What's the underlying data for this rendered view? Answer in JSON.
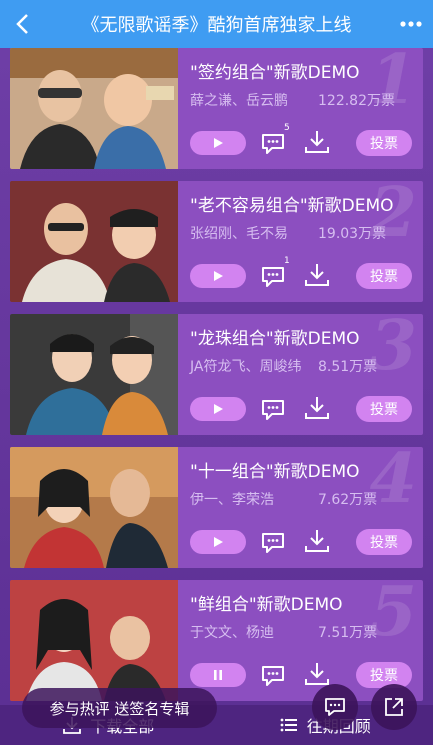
{
  "header": {
    "back_icon": "chevron-left-icon",
    "title": "《无限歌谣季》酷狗首席独家上线",
    "more_icon": "more-dots-icon"
  },
  "songs": [
    {
      "rank": "1",
      "title": "\"签约组合\"新歌DEMO",
      "artists": "薛之谦、岳云鹏",
      "votes": "122.82万票",
      "comments": "5",
      "play_state": "play",
      "vote_label": "投票"
    },
    {
      "rank": "2",
      "title": "\"老不容易组合\"新歌DEMO",
      "artists": "张绍刚、毛不易",
      "votes": "19.03万票",
      "comments": "1",
      "play_state": "play",
      "vote_label": "投票"
    },
    {
      "rank": "3",
      "title": "\"龙珠组合\"新歌DEMO",
      "artists": "JA符龙飞、周峻纬",
      "votes": "8.51万票",
      "comments": "",
      "play_state": "play",
      "vote_label": "投票"
    },
    {
      "rank": "4",
      "title": "\"十一组合\"新歌DEMO",
      "artists": "伊一、李荣浩",
      "votes": "7.62万票",
      "comments": "",
      "play_state": "play",
      "vote_label": "投票"
    },
    {
      "rank": "5",
      "title": "\"鲜组合\"新歌DEMO",
      "artists": "于文文、杨迪",
      "votes": "7.51万票",
      "comments": "",
      "play_state": "pause",
      "vote_label": "投票"
    }
  ],
  "hot_review": "参与热评  送签名专辑",
  "bottom_bar": {
    "download_all": "下载全部",
    "past_review": "往期回顾"
  },
  "colors": {
    "header": "#3f9cf2",
    "card": "#8c4fc0",
    "button": "#d283f0"
  }
}
